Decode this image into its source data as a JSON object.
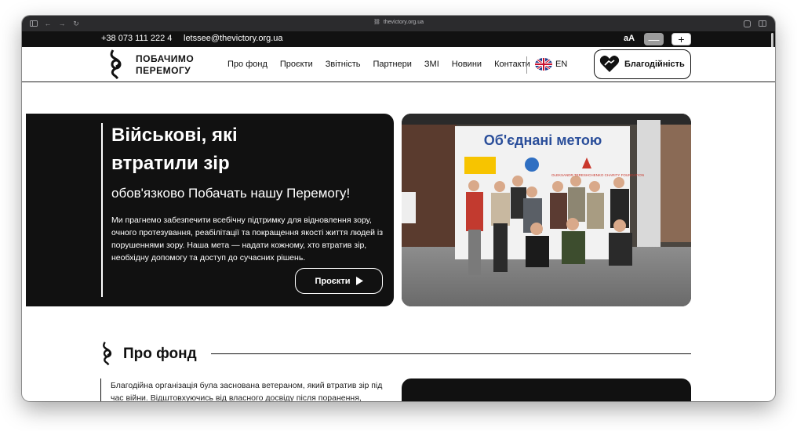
{
  "browser": {
    "url": "thevictory.org.ua"
  },
  "topbar": {
    "phone": "+38 073 111 222 4",
    "email": "letssee@thevictory.org.ua",
    "font_size_label": "aA",
    "decrease_label": "—",
    "increase_label": "+"
  },
  "header": {
    "logo_line1": "ПОБАЧИМО",
    "logo_line2": "ПЕРЕМОГУ",
    "nav": [
      "Про фонд",
      "Проєкти",
      "Звітність",
      "Партнери",
      "ЗМІ",
      "Новини",
      "Контакти"
    ],
    "language": "EN",
    "charity_button": "Благодійність"
  },
  "hero": {
    "title": "Військові, які втратили зір",
    "subtitle": "обов'язково Побачать нашу Перемогу!",
    "text": "Ми прагнемо забезпечити всебічну підтримку для відновлення зору, очного протезування, реабілітації та покращення якості життя людей із порушеннями зору. Наша мета — надати кожному, хто втратив зір, необхідну допомогу та доступ до сучасних рішень.",
    "button": "Проєкти",
    "photo_banner": "Об'єднані метою",
    "photo_sponsor": "OLEKSANDR TERESHCHENKO CHARITY FOUNDATION"
  },
  "about": {
    "title": "Про фонд",
    "text": "Благодійна організація була заснована ветераном, який втратив зір під час війни. Відштовхуючись від власного досвіду після поранення,"
  },
  "colors": {
    "dark": "#111111",
    "white": "#ffffff",
    "chrome": "#2b2b2d"
  }
}
